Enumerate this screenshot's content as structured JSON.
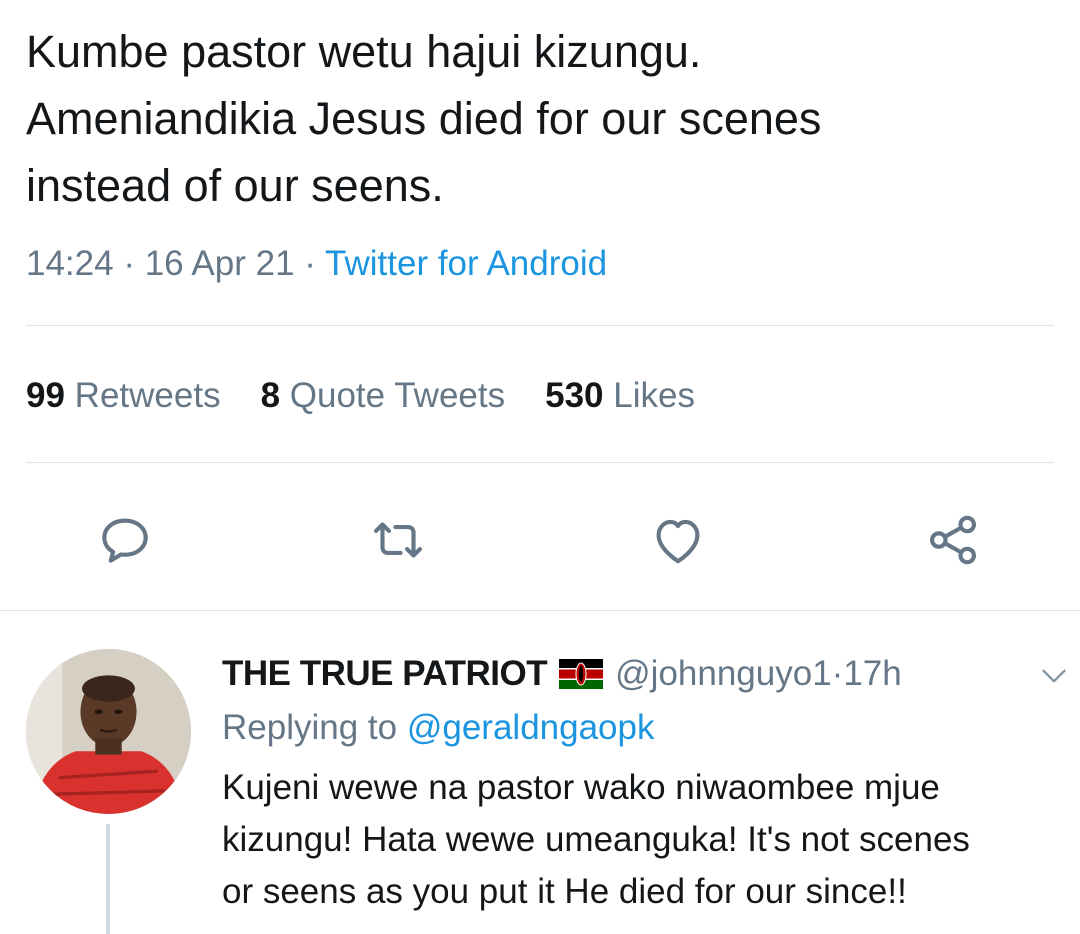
{
  "tweet": {
    "text_lines": [
      "Kumbe pastor wetu hajui kizungu.",
      "Ameniandikia Jesus died for our scenes",
      "instead of our seens."
    ],
    "time": "14:24",
    "date": "16 Apr 21",
    "separator": " · ",
    "source": "Twitter for Android"
  },
  "stats": {
    "retweets_count": "99",
    "retweets_label": "Retweets",
    "quotes_count": "8",
    "quotes_label": "Quote Tweets",
    "likes_count": "530",
    "likes_label": "Likes"
  },
  "actions": [
    {
      "icon": "reply-icon"
    },
    {
      "icon": "retweet-icon"
    },
    {
      "icon": "like-icon"
    },
    {
      "icon": "share-icon"
    }
  ],
  "reply": {
    "name": "THE TRUE PATRIOT",
    "flag_icon": "kenya-flag-icon",
    "handle": "@johnnguyo1",
    "separator": " · ",
    "time": "17h",
    "replying_label": "Replying to",
    "replying_to": "@geraldngaopk",
    "text_lines": [
      "Kujeni wewe na pastor wako niwaombee mjue",
      "kizungu! Hata wewe umeanguka! It's not scenes",
      "or seens as you put it He died for our since!!"
    ]
  },
  "colors": {
    "text": "#14171a",
    "muted": "#657786",
    "link": "#1b95e0",
    "divider": "#dfe3e6",
    "icon": "#657786"
  }
}
